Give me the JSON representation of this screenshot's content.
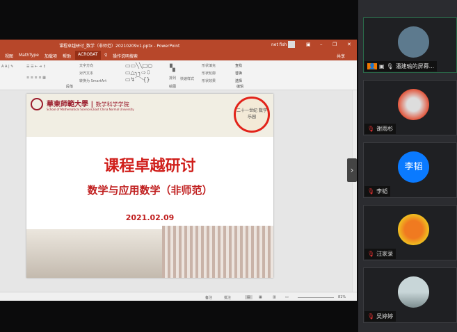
{
  "window": {
    "title": "课程卓越研讨_数学（非师范）20210209v1.pptx - PowerPoint",
    "user": "net fish",
    "min": "–",
    "restore": "❐",
    "close": "✕"
  },
  "menu": {
    "items": [
      "视图",
      "MathType",
      "加载项",
      "帮助",
      "ACROBAT"
    ],
    "tell_me": "操作说明搜索",
    "share": "共享"
  },
  "ribbon": {
    "text_direction": "文字方向",
    "align_text": "对齐文本",
    "convert_smartart": "转换为 SmartArt",
    "arrange": "排列",
    "quick_styles": "快速样式",
    "shape_fill": "形状填充",
    "shape_outline": "形状轮廓",
    "shape_effects": "形状效果",
    "find": "查找",
    "replace": "替换",
    "select": "选择",
    "groups": [
      "段落",
      "绘图",
      "编辑"
    ]
  },
  "slide": {
    "university": "華東師範大學",
    "department": "数学科学学院",
    "department_en": "School of Mathematical Sciences,East China Normal University",
    "seal_text": "二十一世纪 数学乐园",
    "title": "课程卓越研讨",
    "subtitle": "数学与应用数学（非师范）",
    "date": "2021.02.09"
  },
  "status": {
    "notes": "备注",
    "comments": "批注",
    "zoom": "81%"
  },
  "participants": [
    {
      "name": "潘建瑜的屏幕...",
      "avatar_color": "#5d7a8e",
      "muted": false,
      "presenter": true
    },
    {
      "name": "谢雨杉",
      "avatar_color": "#e2553b",
      "muted": true
    },
    {
      "name": "李韬",
      "avatar_text": "李韬",
      "avatar_color": "#0a7aff",
      "muted": true
    },
    {
      "name": "汪家录",
      "avatar_color": "#f0a020",
      "muted": true
    },
    {
      "name": "吴婷婷",
      "avatar_color": "#9fb3b8",
      "muted": true
    }
  ]
}
